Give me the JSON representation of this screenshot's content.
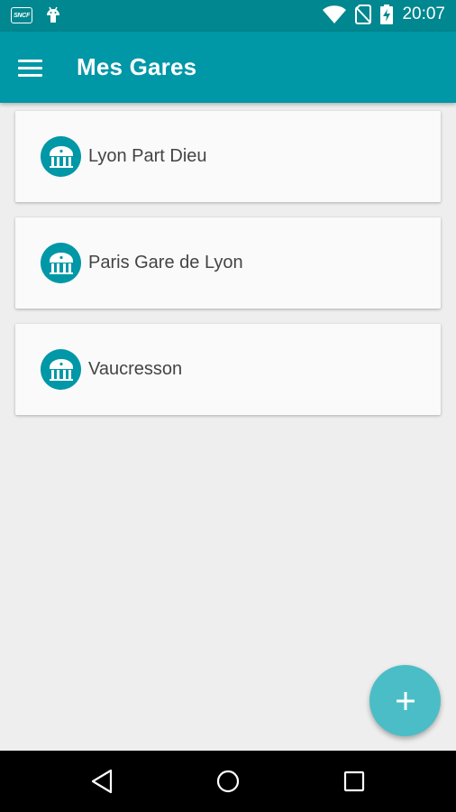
{
  "status_bar": {
    "left_icons": [
      "sncf-logo-icon",
      "android-icon"
    ],
    "sncf_logo_text": "SNCF",
    "right_icons": [
      "wifi-icon",
      "no-sim-icon",
      "battery-charging-icon"
    ],
    "time": "20:07"
  },
  "app_bar": {
    "title": "Mes Gares",
    "menu_icon": "hamburger-menu-icon",
    "color": "#0097a7"
  },
  "stations": [
    {
      "name": "Lyon Part Dieu",
      "icon": "station-building-icon"
    },
    {
      "name": "Paris Gare de Lyon",
      "icon": "station-building-icon"
    },
    {
      "name": "Vaucresson",
      "icon": "station-building-icon"
    }
  ],
  "fab": {
    "icon": "plus-icon",
    "color": "#4bbdc6"
  },
  "nav_bar": {
    "buttons": [
      "back-icon",
      "home-icon",
      "recents-icon"
    ]
  }
}
